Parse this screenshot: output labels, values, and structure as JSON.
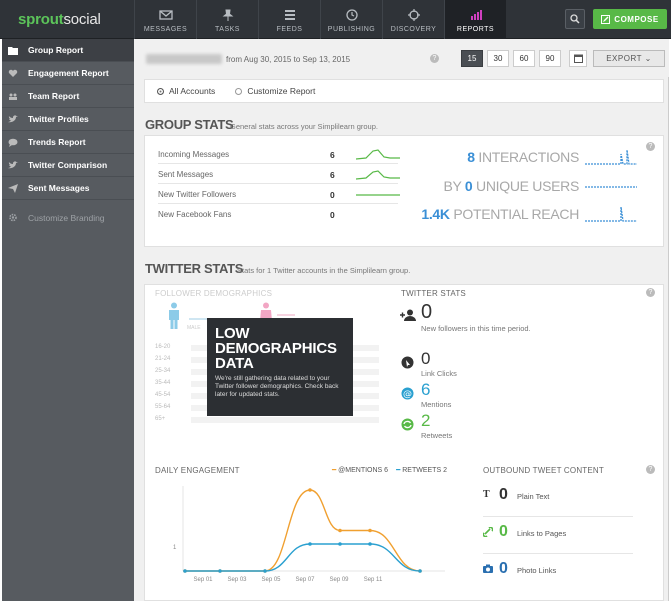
{
  "brand": {
    "part1": "sprout",
    "part2": "social"
  },
  "nav": {
    "tabs": [
      {
        "label": "MESSAGES",
        "icon": "envelope-icon"
      },
      {
        "label": "TASKS",
        "icon": "pin-icon"
      },
      {
        "label": "FEEDS",
        "icon": "list-icon"
      },
      {
        "label": "PUBLISHING",
        "icon": "clock-icon"
      },
      {
        "label": "DISCOVERY",
        "icon": "compass-icon"
      },
      {
        "label": "REPORTS",
        "icon": "bar-chart-icon"
      }
    ],
    "compose_label": "COMPOSE"
  },
  "sidebar": {
    "items": [
      {
        "label": "Group Report",
        "icon": "folder-icon"
      },
      {
        "label": "Engagement Report",
        "icon": "heart-icon"
      },
      {
        "label": "Team Report",
        "icon": "team-icon"
      },
      {
        "label": "Twitter Profiles",
        "icon": "twitter-icon"
      },
      {
        "label": "Trends Report",
        "icon": "speech-bubble-icon"
      },
      {
        "label": "Twitter Comparison",
        "icon": "twitter-compare-icon"
      },
      {
        "label": "Sent Messages",
        "icon": "send-icon"
      }
    ],
    "branding_label": "Customize Branding"
  },
  "header": {
    "date_range": "from Aug 30, 2015 to Sep 13, 2015",
    "ranges": [
      "15",
      "30",
      "60",
      "90"
    ],
    "export_label": "EXPORT"
  },
  "radios": {
    "all": "All Accounts",
    "custom": "Customize Report"
  },
  "group_stats": {
    "title": "GROUP STATS",
    "subtitle": "General stats across your Simplilearn group.",
    "rows": [
      {
        "label": "Incoming Messages",
        "value": "6"
      },
      {
        "label": "Sent Messages",
        "value": "6"
      },
      {
        "label": "New Twitter Followers",
        "value": "0"
      },
      {
        "label": "New Facebook Fans",
        "value": "0"
      }
    ],
    "big": [
      {
        "num": "8",
        "text": "INTERACTIONS"
      },
      {
        "num": "0",
        "text": "UNIQUE USERS",
        "prefix": "BY"
      },
      {
        "num": "1.4K",
        "text": "POTENTIAL REACH"
      }
    ]
  },
  "twitter_stats": {
    "title": "TWITTER STATS",
    "subtitle": "Stats for 1 Twitter accounts in the Simplilearn group.",
    "demographics_label": "FOLLOWER DEMOGRAPHICS",
    "male_label": "MALE",
    "ages": [
      "16-20",
      "21-24",
      "25-34",
      "35-44",
      "45-54",
      "55-64",
      "65+"
    ],
    "overlay_title": "LOW DEMOGRAPHICS DATA",
    "overlay_text": "We're still gathering data related to your Twitter follower demographics. Check back later for updated stats.",
    "stats_label": "TWITTER STATS",
    "new_followers": {
      "n": "0",
      "s": "New followers in this time period."
    },
    "link_clicks": {
      "n": "0",
      "s": "Link Clicks"
    },
    "mentions": {
      "n": "6",
      "s": "Mentions"
    },
    "retweets": {
      "n": "2",
      "s": "Retweets"
    }
  },
  "daily_engagement": {
    "label": "DAILY ENGAGEMENT",
    "legend_mentions": "@MENTIONS 6",
    "legend_retweets": "RETWEETS 2",
    "y_tick": "1",
    "colors": {
      "mentions": "#f0a030",
      "retweets": "#2aa0d0"
    }
  },
  "chart_data": {
    "type": "line",
    "x": [
      "Sep 01",
      "Sep 03",
      "Sep 05",
      "Sep 07",
      "Sep 09",
      "Sep 11"
    ],
    "series": [
      {
        "name": "@MENTIONS",
        "values": [
          0,
          0,
          0,
          3,
          1.5,
          1.5,
          0
        ]
      },
      {
        "name": "RETWEETS",
        "values": [
          0,
          0,
          0,
          1,
          1,
          1,
          0
        ]
      }
    ]
  },
  "outbound": {
    "label": "OUTBOUND TWEET CONTENT",
    "items": [
      {
        "n": "0",
        "s": "Plain Text",
        "icon": "text-icon",
        "color": "#333"
      },
      {
        "n": "0",
        "s": "Links to Pages",
        "icon": "link-icon",
        "color": "#58b947"
      },
      {
        "n": "0",
        "s": "Photo Links",
        "icon": "camera-icon",
        "color": "#2a6fb0"
      }
    ]
  }
}
